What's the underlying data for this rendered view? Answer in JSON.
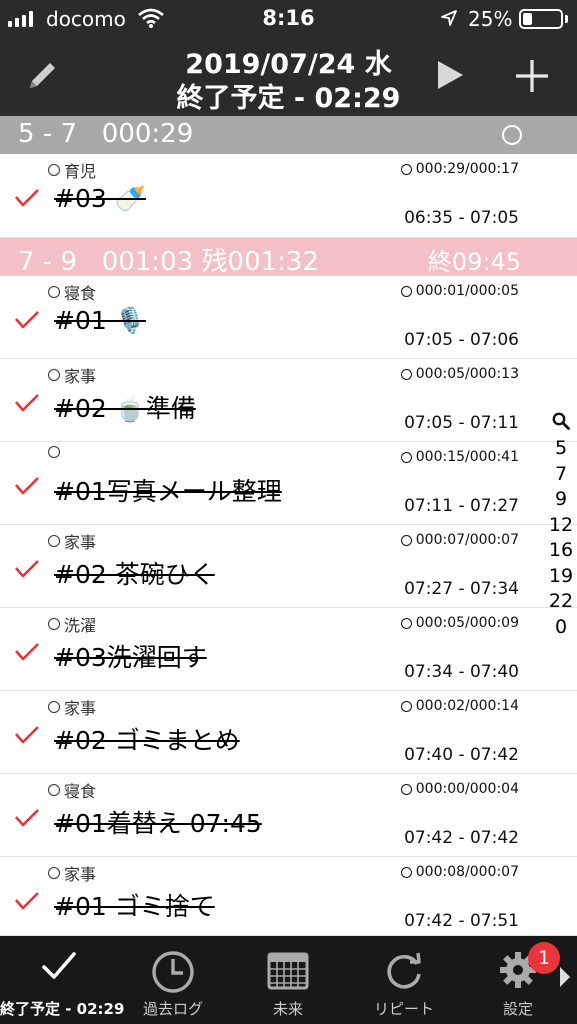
{
  "status": {
    "carrier": "docomo",
    "time": "8:16",
    "battery": "25%",
    "battery_level": 0.25
  },
  "header": {
    "date": "2019/07/24 水",
    "end_time": "終了予定 - 02:29"
  },
  "sections": [
    {
      "label": "5 - 7   000:29",
      "right": ""
    },
    {
      "label": "7 - 9   001:03 残001:32",
      "right": "終09:45"
    }
  ],
  "rows": [
    {
      "category": "育児",
      "elapsed": "000:29/000:17",
      "task": "#03 🍼",
      "range": "06:35 - 07:05"
    },
    {
      "category": "寝食",
      "elapsed": "000:01/000:05",
      "task": "#01 🎙️",
      "range": "07:05 - 07:06"
    },
    {
      "category": "家事",
      "elapsed": "000:05/000:13",
      "task": "#02 🍵準備",
      "range": "07:05 - 07:11"
    },
    {
      "category": "",
      "elapsed": "000:15/000:41",
      "task": "#01写真メール整理",
      "range": "07:11 - 07:27"
    },
    {
      "category": "家事",
      "elapsed": "000:07/000:07",
      "task": "#02 茶碗ひく",
      "range": "07:27 - 07:34"
    },
    {
      "category": "洗濯",
      "elapsed": "000:05/000:09",
      "task": "#03洗濯回す",
      "range": "07:34 - 07:40"
    },
    {
      "category": "家事",
      "elapsed": "000:02/000:14",
      "task": "#02 ゴミまとめ",
      "range": "07:40 - 07:42"
    },
    {
      "category": "寝食",
      "elapsed": "000:00/000:04",
      "task": "#01着替え 07:45",
      "range": "07:42 - 07:42"
    },
    {
      "category": "家事",
      "elapsed": "000:08/000:07",
      "task": "#01 ゴミ捨て",
      "range": "07:42 - 07:51"
    }
  ],
  "index": [
    "5",
    "7",
    "9",
    "12",
    "16",
    "19",
    "22",
    "0"
  ],
  "tabs": [
    {
      "label": "終了予定 - 02:29",
      "icon": "check-icon"
    },
    {
      "label": "過去ログ",
      "icon": "clock-icon"
    },
    {
      "label": "未来",
      "icon": "calendar-icon"
    },
    {
      "label": "リピート",
      "icon": "repeat-icon"
    },
    {
      "label": "設定",
      "icon": "gear-icon"
    }
  ],
  "settings_badge": "1",
  "colors": {
    "header": "#2b2b2b",
    "section_gray": "#a8a8a8",
    "section_pink": "#f4c0c7",
    "check": "#e8343a",
    "tabbar": "#181818"
  }
}
